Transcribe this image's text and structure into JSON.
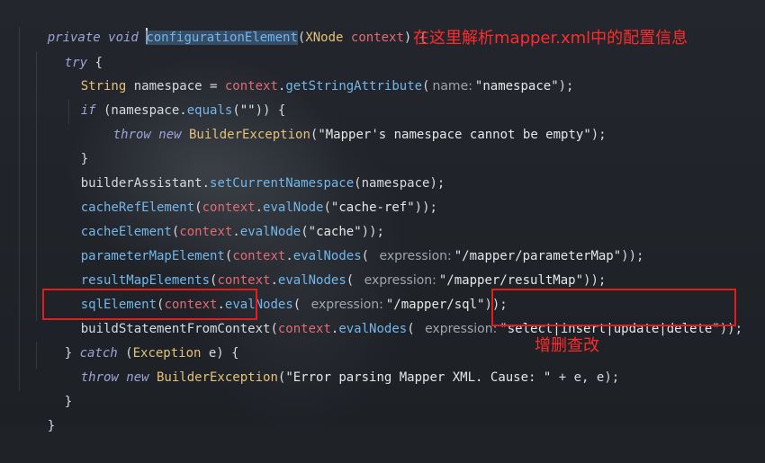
{
  "code": {
    "l1": {
      "kw": "private void",
      "method": "configurationElement",
      "open": "(",
      "param_type": "XNode",
      "param_name": " context",
      "close": ") {"
    },
    "l2": {
      "kw": "try",
      "brace": " {"
    },
    "l3": {
      "type": "String",
      "text1": " namespace = ",
      "obj": "context",
      "dot": ".",
      "fn": "getStringAttribute",
      "open": "(",
      "hint": "name:",
      "str": "\"namespace\"",
      "close": ");"
    },
    "l4": {
      "kw": "if",
      "text1": " (namespace.",
      "fn": "equals",
      "open": "(",
      "str": "\"\"",
      "close": ")) {"
    },
    "l5": {
      "kw": "throw new",
      "type": " BuilderException",
      "open": "(",
      "str": "\"Mapper's namespace cannot be empty\"",
      "close": ");"
    },
    "l6": {
      "text": "}"
    },
    "l7": {
      "text1": "builderAssistant.",
      "fn": "setCurrentNamespace",
      "text2": "(namespace);"
    },
    "l8": {
      "fn": "cacheRefElement",
      "open": "(",
      "obj": "context",
      "dot": ".",
      "fn2": "evalNode",
      "open2": "(",
      "str": "\"cache-ref\"",
      "close": "));"
    },
    "l9": {
      "fn": "cacheElement",
      "open": "(",
      "obj": "context",
      "dot": ".",
      "fn2": "evalNode",
      "open2": "(",
      "str": "\"cache\"",
      "close": "));"
    },
    "l10": {
      "fn": "parameterMapElement",
      "open": "(",
      "obj": "context",
      "dot": ".",
      "fn2": "evalNodes",
      "open2": "(",
      "hint": "expression:",
      "str": "\"/mapper/parameterMap\"",
      "close": "));"
    },
    "l11": {
      "fn": "resultMapElements",
      "open": "(",
      "obj": "context",
      "dot": ".",
      "fn2": "evalNodes",
      "open2": "(",
      "hint": "expression:",
      "str": "\"/mapper/resultMap\"",
      "close": "));"
    },
    "l12": {
      "fn": "sqlElement",
      "open": "(",
      "obj": "context",
      "dot": ".",
      "fn2": "evalNodes",
      "open2": "(",
      "hint": "expression:",
      "str": "\"/mapper/sql\"",
      "close": "));"
    },
    "l13": {
      "fn": "buildStatementFromContext",
      "open": "(",
      "obj": "context",
      "dot": ".",
      "fn2": "evalNodes",
      "open2": "(",
      "hint": "expression:",
      "str": "\"select|insert|update|delete\"",
      "close": "));"
    },
    "l14": {
      "brace": "} ",
      "kw": "catch",
      "open": " (",
      "type": "Exception",
      "text": " e) {"
    },
    "l15": {
      "kw": "throw new",
      "type": " BuilderException",
      "open": "(",
      "str": "\"Error parsing Mapper XML. Cause: \"",
      "text": " + e, e);"
    },
    "l16": {
      "text": "}"
    },
    "l17": {
      "text": "}"
    }
  },
  "annotations": {
    "parse_note": "在这里解析mapper.xml中的配置信息",
    "crud_note": "增删查改",
    "color": "#ff2a2a"
  }
}
